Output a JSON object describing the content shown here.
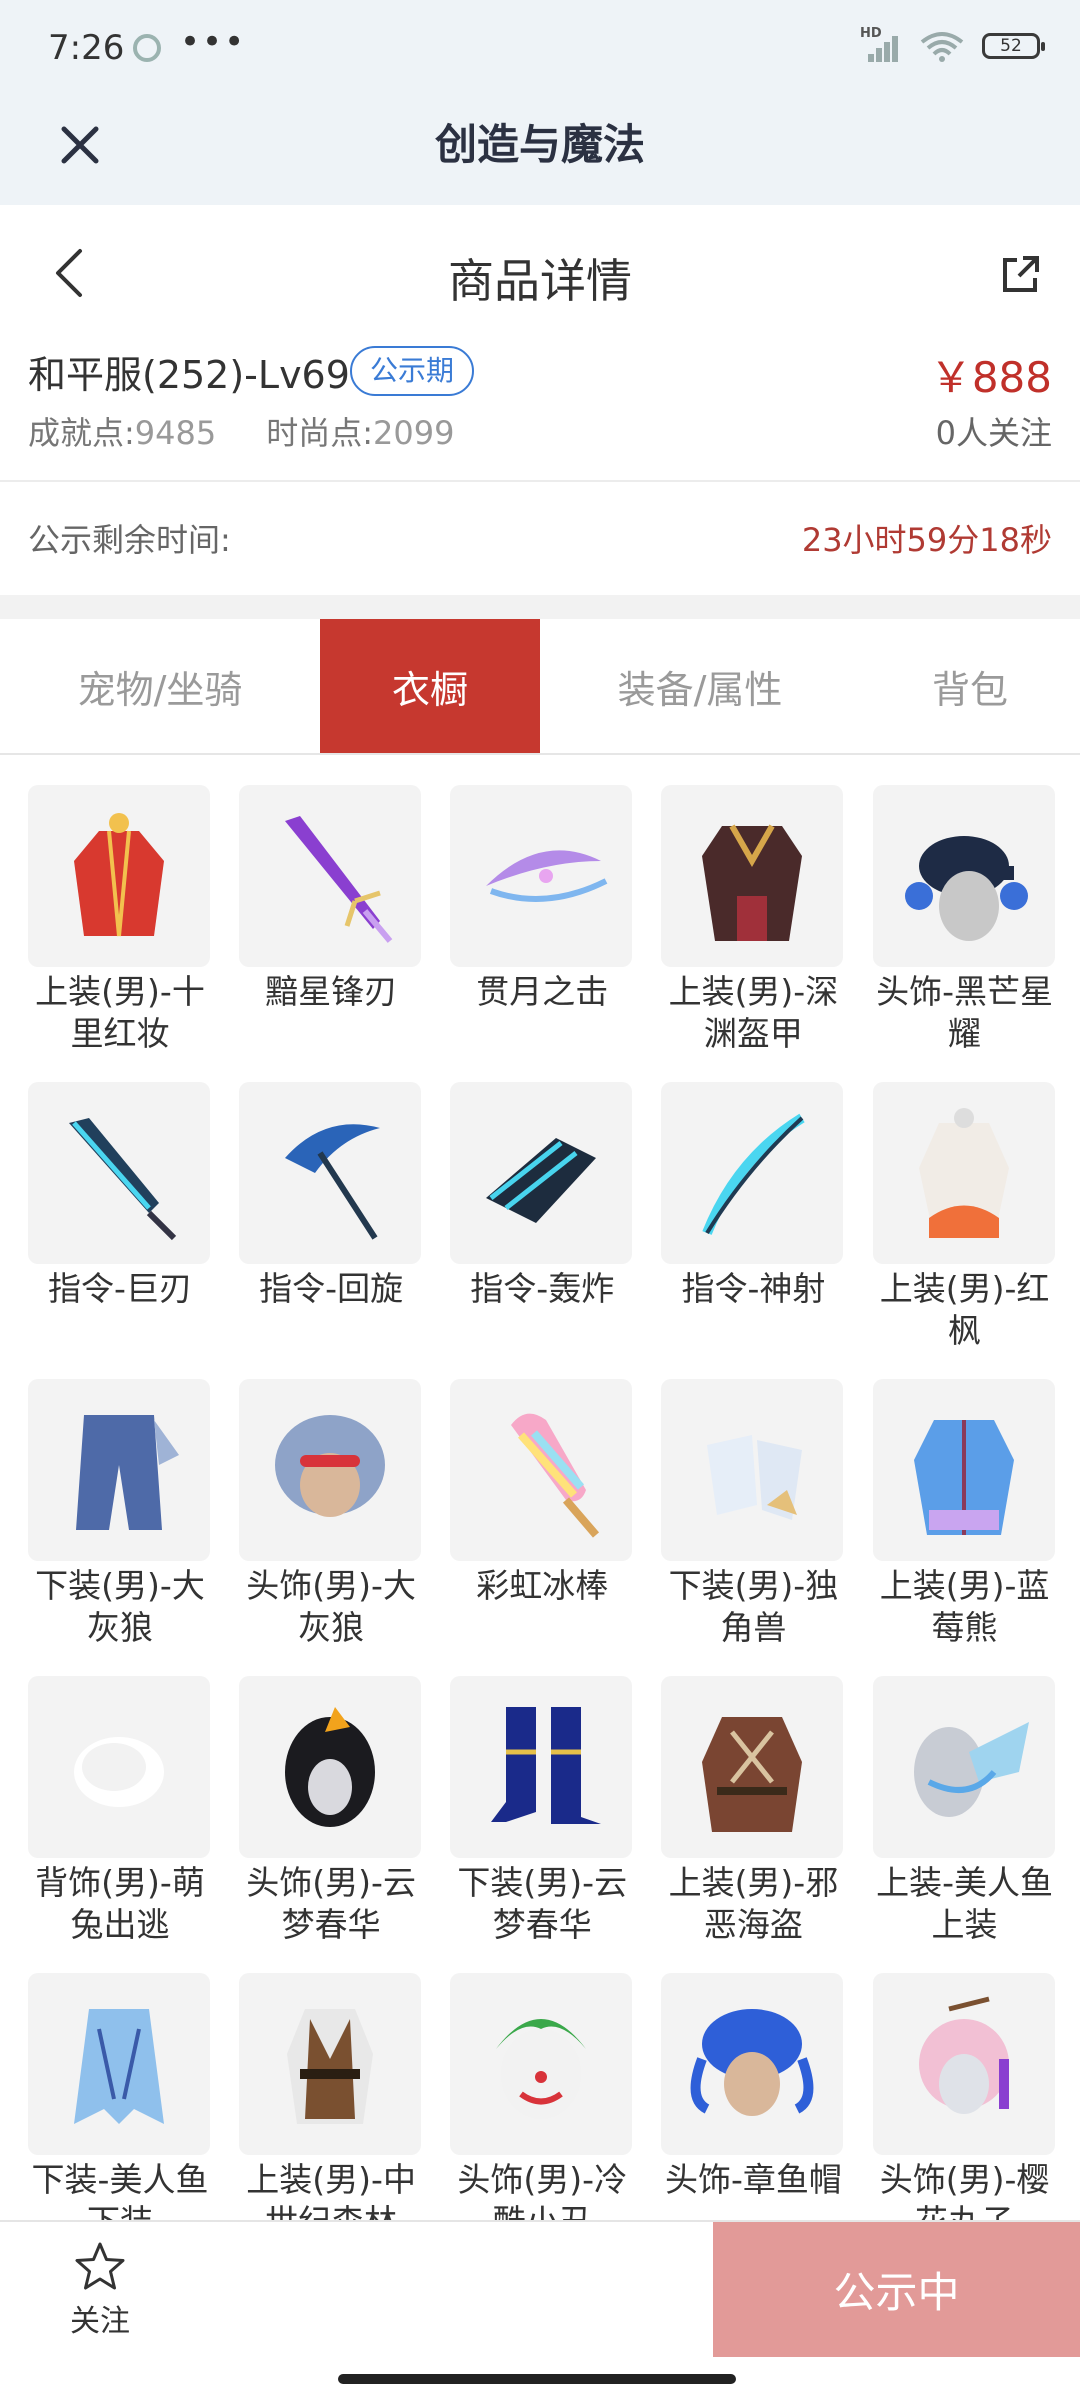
{
  "status_bar": {
    "time": "7:26",
    "dots": "•••",
    "signal_label": "HD",
    "battery": "52"
  },
  "app_bar": {
    "title": "创造与魔法",
    "close_icon": "close-icon"
  },
  "header": {
    "title": "商品详情",
    "back_icon": "chevron-left-icon",
    "share_icon": "share-icon"
  },
  "product": {
    "name": "和平服(252)-Lv69",
    "badge": "公示期",
    "price": "￥888",
    "achievement_label": "成就点:",
    "achievement_value": "9485",
    "fashion_label": "时尚点:",
    "fashion_value": "2099",
    "followers": "0人关注"
  },
  "countdown": {
    "label": "公示剩余时间:",
    "value": "23小时59分18秒"
  },
  "tabs": [
    {
      "label": "宠物/坐骑",
      "active": false
    },
    {
      "label": "衣橱",
      "active": true
    },
    {
      "label": "装备/属性",
      "active": false
    },
    {
      "label": "背包",
      "active": false
    }
  ],
  "items": [
    {
      "label": "上装(男)-十里红妆",
      "icon": "red-robe"
    },
    {
      "label": "黯星锋刃",
      "icon": "purple-blade"
    },
    {
      "label": "贯月之击",
      "icon": "crescent-bow"
    },
    {
      "label": "上装(男)-深渊盔甲",
      "icon": "dark-armor"
    },
    {
      "label": "头饰-黑芒星耀",
      "icon": "cap-headphones"
    },
    {
      "label": "指令-巨刃",
      "icon": "blue-greatsword"
    },
    {
      "label": "指令-回旋",
      "icon": "blue-scythe"
    },
    {
      "label": "指令-轰炸",
      "icon": "blue-cannon"
    },
    {
      "label": "指令-神射",
      "icon": "blue-bow"
    },
    {
      "label": "上装(男)-红枫",
      "icon": "red-maple-outfit"
    },
    {
      "label": "下装(男)-大灰狼",
      "icon": "blue-pants"
    },
    {
      "label": "头饰(男)-大灰狼",
      "icon": "wolf-hood"
    },
    {
      "label": "彩虹冰棒",
      "icon": "rainbow-popsicle"
    },
    {
      "label": "下装(男)-独角兽",
      "icon": "white-boots"
    },
    {
      "label": "上装(男)-蓝莓熊",
      "icon": "blue-jacket"
    },
    {
      "label": "背饰(男)-萌兔出逃",
      "icon": "white-fluff"
    },
    {
      "label": "头饰(男)-云梦春华",
      "icon": "black-hair"
    },
    {
      "label": "下装(男)-云梦春华",
      "icon": "navy-boots"
    },
    {
      "label": "上装(男)-邪恶海盗",
      "icon": "pirate-coat"
    },
    {
      "label": "上装-美人鱼上装",
      "icon": "mermaid-top"
    },
    {
      "label": "下装-美人鱼下装",
      "icon": "mermaid-bottom"
    },
    {
      "label": "上装(男)-中世纪森林",
      "icon": "forest-vest"
    },
    {
      "label": "头饰(男)-冷酷小丑",
      "icon": "clown-mask"
    },
    {
      "label": "头饰-章鱼帽",
      "icon": "octopus-hat"
    },
    {
      "label": "头饰(男)-樱花丸子",
      "icon": "sakura-hair"
    }
  ],
  "bottom_bar": {
    "follow_label": "关注",
    "follow_icon": "star-outline-icon",
    "status_button": "公示中"
  },
  "colors": {
    "accent_red": "#c6382f",
    "price_red": "#c0302a",
    "badge_blue": "#3a7bd5",
    "disabled_button": "#e29a98"
  }
}
